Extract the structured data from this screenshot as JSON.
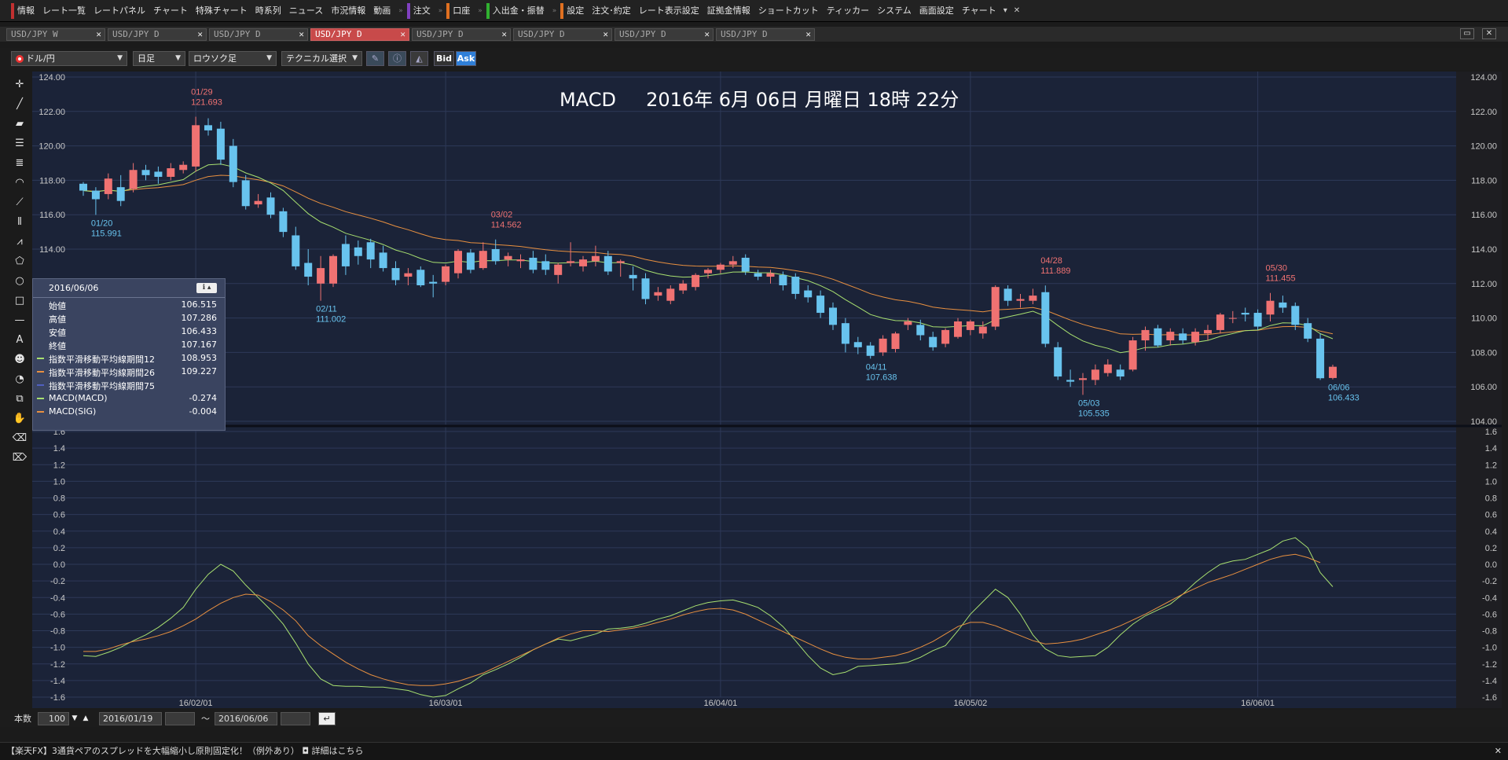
{
  "menu": {
    "items": [
      {
        "label": "情報",
        "mark": "red"
      },
      {
        "label": "レート一覧"
      },
      {
        "label": "レートパネル"
      },
      {
        "label": "チャート"
      },
      {
        "label": "特殊チャート"
      },
      {
        "label": "時系列"
      },
      {
        "label": "ニュース"
      },
      {
        "label": "市況情報"
      },
      {
        "label": "動画"
      },
      {
        "label": "注文",
        "mark": "purple"
      },
      {
        "label": "口座",
        "mark": "orange"
      },
      {
        "label": "入出金・振替",
        "mark": "green"
      },
      {
        "label": "設定",
        "mark": "orange"
      },
      {
        "label": "注文･約定"
      },
      {
        "label": "レート表示設定"
      },
      {
        "label": "証拠金情報"
      },
      {
        "label": "ショートカット"
      },
      {
        "label": "ティッカー"
      },
      {
        "label": "システム"
      },
      {
        "label": "画面設定"
      },
      {
        "label": "チャート"
      }
    ],
    "more": "▾",
    "close": "✕"
  },
  "tabs": [
    {
      "label": "USD/JPY W",
      "active": false
    },
    {
      "label": "USD/JPY D",
      "active": false
    },
    {
      "label": "USD/JPY D",
      "active": false
    },
    {
      "label": "USD/JPY D",
      "active": true
    },
    {
      "label": "USD/JPY D",
      "active": false
    },
    {
      "label": "USD/JPY D",
      "active": false
    },
    {
      "label": "USD/JPY D",
      "active": false
    },
    {
      "label": "USD/JPY D",
      "active": false
    }
  ],
  "tab_close": "✕",
  "toolbar": {
    "pair": "ドル/円",
    "period": "日足",
    "chart_type": "ロウソク足",
    "technical": "テクニカル選択",
    "bid": "Bid",
    "ask": "Ask",
    "pen_icon": "pencil-icon",
    "info_icon": "info-icon",
    "mountain_icon": "mountain-chart-icon"
  },
  "chart_title": "MACD     2016年 6月 06日 月曜日 18時 22分",
  "sub_label": "MACD",
  "colors": {
    "bg": "#1b2338",
    "up": "#f07272",
    "down": "#68c3ee",
    "ema12": "#a8e070",
    "ema26": "#e89040",
    "macd": "#a8e070",
    "signal": "#e89040",
    "annot_high": "#f07272",
    "annot_low": "#68c3ee"
  },
  "info_panel": {
    "date": "2016/06/06",
    "rows": [
      {
        "k": "始値",
        "v": "106.515",
        "swatch": ""
      },
      {
        "k": "高値",
        "v": "107.286",
        "swatch": ""
      },
      {
        "k": "安値",
        "v": "106.433",
        "swatch": ""
      },
      {
        "k": "終値",
        "v": "107.167",
        "swatch": ""
      },
      {
        "k": "指数平滑移動平均線期間12",
        "v": "108.953",
        "swatch": "#a8e070"
      },
      {
        "k": "指数平滑移動平均線期間26",
        "v": "109.227",
        "swatch": "#e89040"
      },
      {
        "k": "指数平滑移動平均線期間75",
        "v": "",
        "swatch": "#5060c0"
      },
      {
        "k": "MACD(MACD)",
        "v": "-0.274",
        "swatch": "#a8e070"
      },
      {
        "k": "MACD(SIG)",
        "v": "-0.004",
        "swatch": "#e89040"
      }
    ]
  },
  "bottom": {
    "count_label": "本数",
    "count": "100",
    "from": "2016/01/19",
    "tilde": "〜",
    "to": "2016/06/06"
  },
  "ticker": {
    "text": "【楽天FX】3通貨ペアのスプレッドを大幅縮小し原則固定化！（例外あり） ◘ 詳細はこちら",
    "close": "✕"
  },
  "chart_data": [
    {
      "type": "candlestick",
      "title": "MACD     2016年 6月 06日 月曜日 18時 22分",
      "ylim": [
        104,
        124
      ],
      "yticks": [
        "124.00",
        "122.00",
        "120.00",
        "118.00",
        "116.00",
        "114.00",
        "112.00",
        "110.00",
        "108.00",
        "106.00",
        "104.00"
      ],
      "xticks": [
        {
          "label": "16/02/01",
          "index": 9
        },
        {
          "label": "16/03/01",
          "index": 29
        },
        {
          "label": "16/04/01",
          "index": 51
        },
        {
          "label": "16/05/02",
          "index": 71
        },
        {
          "label": "16/06/01",
          "index": 94
        }
      ],
      "ohlc": [
        [
          117.8,
          117.9,
          117.1,
          117.4
        ],
        [
          117.4,
          117.6,
          115.99,
          116.9
        ],
        [
          117.2,
          118.4,
          116.9,
          118.1
        ],
        [
          117.6,
          118.3,
          116.5,
          116.8
        ],
        [
          117.5,
          119.0,
          117.3,
          118.6
        ],
        [
          118.6,
          118.9,
          118.0,
          118.3
        ],
        [
          118.5,
          118.8,
          117.8,
          118.2
        ],
        [
          118.2,
          119.0,
          118.0,
          118.7
        ],
        [
          118.6,
          119.1,
          118.4,
          118.9
        ],
        [
          118.8,
          121.693,
          118.5,
          121.2
        ],
        [
          121.2,
          121.6,
          120.6,
          120.9
        ],
        [
          121.0,
          121.4,
          118.9,
          119.2
        ],
        [
          120.0,
          120.4,
          117.6,
          117.9
        ],
        [
          118.0,
          118.3,
          116.3,
          116.5
        ],
        [
          116.6,
          117.2,
          116.4,
          116.8
        ],
        [
          117.0,
          117.3,
          115.8,
          116.0
        ],
        [
          116.2,
          116.4,
          114.7,
          115.0
        ],
        [
          114.8,
          115.3,
          112.8,
          113.0
        ],
        [
          113.2,
          114.0,
          111.9,
          112.4
        ],
        [
          112.0,
          113.6,
          111.002,
          112.9
        ],
        [
          112.0,
          113.7,
          111.8,
          113.6
        ],
        [
          114.3,
          114.8,
          112.5,
          113.0
        ],
        [
          114.1,
          114.5,
          113.1,
          113.6
        ],
        [
          114.4,
          114.6,
          112.9,
          113.4
        ],
        [
          113.8,
          114.2,
          112.7,
          112.9
        ],
        [
          112.9,
          113.3,
          111.9,
          112.2
        ],
        [
          112.4,
          112.9,
          111.9,
          112.6
        ],
        [
          112.8,
          113.0,
          111.8,
          111.9
        ],
        [
          112.1,
          112.5,
          111.2,
          112.0
        ],
        [
          112.1,
          113.1,
          111.9,
          113.0
        ],
        [
          112.6,
          114.0,
          112.3,
          113.9
        ],
        [
          113.8,
          114.0,
          112.6,
          112.8
        ],
        [
          112.9,
          114.4,
          112.8,
          113.9
        ],
        [
          114.0,
          114.562,
          113.1,
          113.3
        ],
        [
          113.4,
          113.8,
          113.0,
          113.6
        ],
        [
          113.3,
          113.7,
          112.9,
          113.4
        ],
        [
          113.5,
          113.9,
          112.6,
          112.8
        ],
        [
          113.3,
          113.7,
          112.5,
          112.8
        ],
        [
          112.5,
          113.2,
          112.0,
          113.1
        ],
        [
          113.2,
          114.4,
          113.0,
          113.3
        ],
        [
          113.0,
          113.6,
          112.7,
          113.4
        ],
        [
          113.3,
          114.2,
          113.0,
          113.6
        ],
        [
          113.6,
          113.9,
          112.5,
          112.7
        ],
        [
          113.2,
          113.4,
          112.4,
          113.3
        ],
        [
          112.5,
          113.0,
          111.6,
          112.3
        ],
        [
          112.3,
          112.6,
          110.8,
          111.1
        ],
        [
          111.3,
          111.8,
          111.0,
          111.5
        ],
        [
          111.0,
          111.9,
          110.8,
          111.7
        ],
        [
          111.6,
          112.2,
          111.4,
          112.0
        ],
        [
          111.8,
          112.6,
          111.6,
          112.5
        ],
        [
          112.6,
          112.9,
          112.3,
          112.8
        ],
        [
          112.8,
          113.2,
          112.6,
          113.1
        ],
        [
          113.1,
          113.6,
          112.9,
          113.3
        ],
        [
          113.5,
          113.7,
          112.5,
          112.7
        ],
        [
          112.6,
          112.8,
          112.2,
          112.4
        ],
        [
          112.4,
          112.8,
          112.0,
          112.6
        ],
        [
          112.5,
          112.7,
          111.6,
          111.9
        ],
        [
          112.4,
          112.6,
          111.1,
          111.4
        ],
        [
          111.6,
          111.9,
          110.9,
          111.2
        ],
        [
          111.3,
          111.6,
          110.0,
          110.3
        ],
        [
          110.6,
          110.9,
          109.3,
          109.6
        ],
        [
          109.7,
          110.0,
          108.0,
          108.5
        ],
        [
          108.6,
          108.9,
          107.9,
          108.3
        ],
        [
          108.4,
          108.6,
          107.638,
          107.8
        ],
        [
          108.0,
          109.0,
          107.8,
          108.8
        ],
        [
          108.2,
          109.2,
          108.0,
          109.1
        ],
        [
          109.6,
          110.0,
          109.3,
          109.8
        ],
        [
          109.6,
          109.9,
          108.7,
          109.0
        ],
        [
          108.9,
          109.2,
          108.1,
          108.3
        ],
        [
          108.5,
          109.4,
          108.3,
          109.3
        ],
        [
          108.9,
          110.0,
          108.8,
          109.8
        ],
        [
          109.3,
          109.9,
          109.0,
          109.8
        ],
        [
          109.1,
          109.8,
          108.8,
          109.5
        ],
        [
          109.5,
          111.9,
          109.3,
          111.8
        ],
        [
          111.7,
          111.9,
          110.7,
          111.0
        ],
        [
          111.0,
          111.4,
          110.6,
          111.1
        ],
        [
          111.0,
          111.7,
          110.8,
          111.3
        ],
        [
          111.5,
          111.889,
          108.3,
          108.5
        ],
        [
          108.3,
          108.6,
          106.4,
          106.6
        ],
        [
          106.4,
          107.0,
          106.0,
          106.3
        ],
        [
          106.4,
          106.8,
          105.535,
          106.5
        ],
        [
          106.4,
          107.3,
          106.1,
          107.0
        ],
        [
          106.8,
          107.6,
          106.6,
          107.3
        ],
        [
          107.0,
          107.3,
          106.4,
          106.6
        ],
        [
          107.0,
          108.9,
          106.9,
          108.7
        ],
        [
          108.7,
          109.5,
          108.1,
          109.3
        ],
        [
          109.4,
          109.6,
          108.3,
          108.4
        ],
        [
          108.7,
          109.4,
          108.4,
          109.2
        ],
        [
          109.1,
          109.4,
          108.5,
          108.7
        ],
        [
          108.6,
          109.4,
          108.4,
          109.2
        ],
        [
          109.1,
          109.6,
          108.7,
          109.3
        ],
        [
          109.3,
          110.3,
          109.1,
          110.2
        ],
        [
          110.0,
          110.4,
          109.7,
          110.0
        ],
        [
          110.3,
          110.6,
          109.8,
          110.2
        ],
        [
          110.3,
          110.5,
          109.3,
          109.5
        ],
        [
          110.2,
          111.455,
          109.8,
          111.0
        ],
        [
          110.9,
          111.3,
          110.3,
          110.6
        ],
        [
          110.7,
          110.9,
          109.3,
          109.6
        ],
        [
          109.7,
          110.0,
          108.6,
          108.8
        ],
        [
          108.8,
          109.1,
          106.4,
          106.5
        ],
        [
          106.515,
          107.286,
          106.433,
          107.167
        ]
      ],
      "ema12_visible": true,
      "ema26_visible": true,
      "annotations": [
        {
          "index": 1,
          "date": "01/20",
          "value": "115.991",
          "kind": "low"
        },
        {
          "index": 9,
          "date": "01/29",
          "value": "121.693",
          "kind": "high"
        },
        {
          "index": 19,
          "date": "02/11",
          "value": "111.002",
          "kind": "low"
        },
        {
          "index": 33,
          "date": "03/02",
          "value": "114.562",
          "kind": "high"
        },
        {
          "index": 63,
          "date": "04/11",
          "value": "107.638",
          "kind": "low"
        },
        {
          "index": 77,
          "date": "04/28",
          "value": "111.889",
          "kind": "high"
        },
        {
          "index": 80,
          "date": "05/03",
          "value": "105.535",
          "kind": "low"
        },
        {
          "index": 95,
          "date": "05/30",
          "value": "111.455",
          "kind": "high"
        },
        {
          "index": 100,
          "date": "06/06",
          "value": "106.433",
          "kind": "low"
        }
      ]
    },
    {
      "type": "line",
      "title": "MACD",
      "ylim": [
        -1.6,
        1.6
      ],
      "yticks": [
        "1.6",
        "1.4",
        "1.2",
        "1.0",
        "0.8",
        "0.6",
        "0.4",
        "0.2",
        "0.0",
        "-0.2",
        "-0.4",
        "-0.6",
        "-0.8",
        "-1.0",
        "-1.2",
        "-1.4",
        "-1.6"
      ],
      "series": [
        {
          "name": "MACD(MACD)",
          "values": [
            -1.1,
            -1.11,
            -1.06,
            -1.0,
            -0.92,
            -0.85,
            -0.76,
            -0.65,
            -0.52,
            -0.3,
            -0.12,
            0.0,
            -0.08,
            -0.25,
            -0.4,
            -0.55,
            -0.72,
            -0.95,
            -1.2,
            -1.38,
            -1.46,
            -1.47,
            -1.47,
            -1.48,
            -1.48,
            -1.5,
            -1.52,
            -1.57,
            -1.6,
            -1.58,
            -1.5,
            -1.43,
            -1.33,
            -1.27,
            -1.2,
            -1.12,
            -1.03,
            -0.96,
            -0.9,
            -0.92,
            -0.88,
            -0.84,
            -0.78,
            -0.77,
            -0.75,
            -0.71,
            -0.66,
            -0.62,
            -0.56,
            -0.5,
            -0.46,
            -0.44,
            -0.43,
            -0.47,
            -0.52,
            -0.62,
            -0.75,
            -0.92,
            -1.1,
            -1.25,
            -1.33,
            -1.3,
            -1.23,
            -1.22,
            -1.21,
            -1.2,
            -1.18,
            -1.12,
            -1.04,
            -0.98,
            -0.8,
            -0.6,
            -0.45,
            -0.3,
            -0.4,
            -0.6,
            -0.85,
            -1.02,
            -1.1,
            -1.12,
            -1.11,
            -1.1,
            -1.0,
            -0.85,
            -0.72,
            -0.62,
            -0.55,
            -0.48,
            -0.36,
            -0.22,
            -0.1,
            0.0,
            0.04,
            0.06,
            0.12,
            0.18,
            0.28,
            0.32,
            0.2,
            -0.1,
            -0.27
          ]
        },
        {
          "name": "MACD(SIG)",
          "values": [
            -1.05,
            -1.05,
            -1.02,
            -0.97,
            -0.93,
            -0.9,
            -0.86,
            -0.81,
            -0.74,
            -0.66,
            -0.56,
            -0.47,
            -0.4,
            -0.36,
            -0.37,
            -0.45,
            -0.55,
            -0.68,
            -0.86,
            -0.98,
            -1.08,
            -1.18,
            -1.26,
            -1.33,
            -1.38,
            -1.42,
            -1.45,
            -1.46,
            -1.46,
            -1.44,
            -1.41,
            -1.36,
            -1.31,
            -1.24,
            -1.17,
            -1.1,
            -1.03,
            -0.96,
            -0.89,
            -0.84,
            -0.8,
            -0.8,
            -0.81,
            -0.79,
            -0.77,
            -0.74,
            -0.7,
            -0.66,
            -0.61,
            -0.57,
            -0.54,
            -0.53,
            -0.55,
            -0.6,
            -0.67,
            -0.74,
            -0.81,
            -0.88,
            -0.95,
            -1.02,
            -1.08,
            -1.12,
            -1.14,
            -1.14,
            -1.12,
            -1.1,
            -1.06,
            -1.0,
            -0.93,
            -0.84,
            -0.75,
            -0.7,
            -0.7,
            -0.74,
            -0.8,
            -0.86,
            -0.92,
            -0.96,
            -0.95,
            -0.93,
            -0.9,
            -0.85,
            -0.8,
            -0.74,
            -0.67,
            -0.6,
            -0.52,
            -0.44,
            -0.36,
            -0.29,
            -0.22,
            -0.17,
            -0.12,
            -0.06,
            0.0,
            0.06,
            0.1,
            0.12,
            0.08,
            0.02
          ]
        }
      ]
    }
  ]
}
